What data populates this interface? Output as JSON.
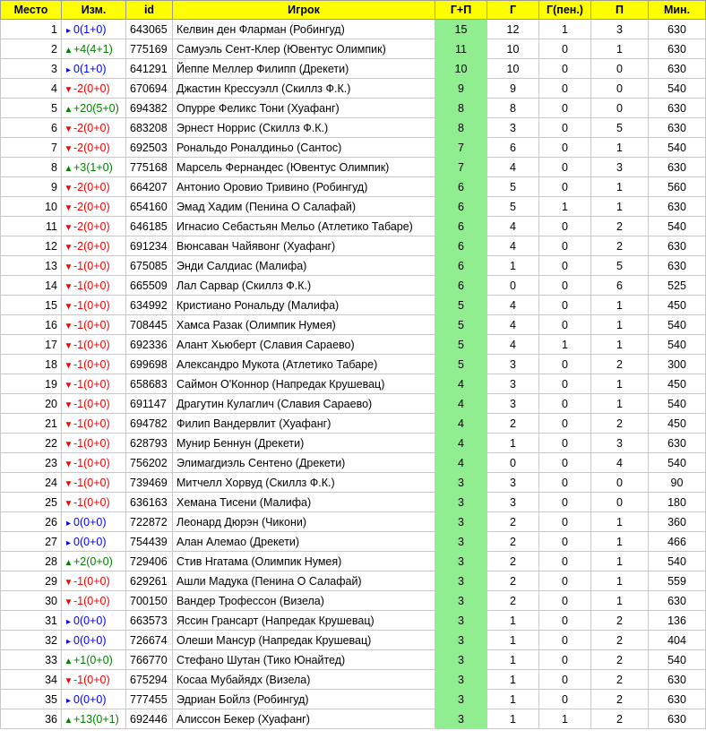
{
  "headers": [
    "Место",
    "Изм.",
    "id",
    "Игрок",
    "Г+П",
    "Г",
    "Г(пен.)",
    "П",
    "Мин."
  ],
  "colors": {
    "header_bg": "#ffff00",
    "gp_bg": "#90ee90",
    "up": "#008000",
    "down": "#ff0000",
    "same": "#0000ff"
  },
  "rows": [
    {
      "rank": "1",
      "dir": "same",
      "chg": "0(1+0)",
      "id": "643065",
      "name": "Келвин ден Фларман (Робингуд)",
      "gp": "15",
      "g": "12",
      "gpen": "1",
      "p": "3",
      "min": "630"
    },
    {
      "rank": "2",
      "dir": "up",
      "chg": "+4(4+1)",
      "id": "775169",
      "name": "Самуэль Сент-Клер (Ювентус Олимпик)",
      "gp": "11",
      "g": "10",
      "gpen": "0",
      "p": "1",
      "min": "630"
    },
    {
      "rank": "3",
      "dir": "same",
      "chg": "0(1+0)",
      "id": "641291",
      "name": "Йеппе Меллер Филипп (Дрекети)",
      "gp": "10",
      "g": "10",
      "gpen": "0",
      "p": "0",
      "min": "630"
    },
    {
      "rank": "4",
      "dir": "down",
      "chg": "-2(0+0)",
      "id": "670694",
      "name": "Джастин Крессуэлл (Скиллз Ф.К.)",
      "gp": "9",
      "g": "9",
      "gpen": "0",
      "p": "0",
      "min": "540"
    },
    {
      "rank": "5",
      "dir": "up",
      "chg": "+20(5+0)",
      "id": "694382",
      "name": "Опурре Феликс Тони (Хуафанг)",
      "gp": "8",
      "g": "8",
      "gpen": "0",
      "p": "0",
      "min": "630"
    },
    {
      "rank": "6",
      "dir": "down",
      "chg": "-2(0+0)",
      "id": "683208",
      "name": "Эрнест Норрис (Скиллз Ф.К.)",
      "gp": "8",
      "g": "3",
      "gpen": "0",
      "p": "5",
      "min": "630"
    },
    {
      "rank": "7",
      "dir": "down",
      "chg": "-2(0+0)",
      "id": "692503",
      "name": "Рональдо Роналдиньо (Сантос)",
      "gp": "7",
      "g": "6",
      "gpen": "0",
      "p": "1",
      "min": "540"
    },
    {
      "rank": "8",
      "dir": "up",
      "chg": "+3(1+0)",
      "id": "775168",
      "name": "Марсель Фернандес (Ювентус Олимпик)",
      "gp": "7",
      "g": "4",
      "gpen": "0",
      "p": "3",
      "min": "630"
    },
    {
      "rank": "9",
      "dir": "down",
      "chg": "-2(0+0)",
      "id": "664207",
      "name": "Антонио Оровио Тривино (Робингуд)",
      "gp": "6",
      "g": "5",
      "gpen": "0",
      "p": "1",
      "min": "560"
    },
    {
      "rank": "10",
      "dir": "down",
      "chg": "-2(0+0)",
      "id": "654160",
      "name": "Эмад Хадим (Пенина О Салафай)",
      "gp": "6",
      "g": "5",
      "gpen": "1",
      "p": "1",
      "min": "630"
    },
    {
      "rank": "11",
      "dir": "down",
      "chg": "-2(0+0)",
      "id": "646185",
      "name": "Игнасио Себастьян Мельо (Атлетико Табаре)",
      "gp": "6",
      "g": "4",
      "gpen": "0",
      "p": "2",
      "min": "540"
    },
    {
      "rank": "12",
      "dir": "down",
      "chg": "-2(0+0)",
      "id": "691234",
      "name": "Вюнсаван Чайявонг (Хуафанг)",
      "gp": "6",
      "g": "4",
      "gpen": "0",
      "p": "2",
      "min": "630"
    },
    {
      "rank": "13",
      "dir": "down",
      "chg": "-1(0+0)",
      "id": "675085",
      "name": "Энди Салдиас (Малифа)",
      "gp": "6",
      "g": "1",
      "gpen": "0",
      "p": "5",
      "min": "630"
    },
    {
      "rank": "14",
      "dir": "down",
      "chg": "-1(0+0)",
      "id": "665509",
      "name": "Лал Сарвар (Скиллз Ф.К.)",
      "gp": "6",
      "g": "0",
      "gpen": "0",
      "p": "6",
      "min": "525"
    },
    {
      "rank": "15",
      "dir": "down",
      "chg": "-1(0+0)",
      "id": "634992",
      "name": "Кристиано Рональду (Малифа)",
      "gp": "5",
      "g": "4",
      "gpen": "0",
      "p": "1",
      "min": "450"
    },
    {
      "rank": "16",
      "dir": "down",
      "chg": "-1(0+0)",
      "id": "708445",
      "name": "Хамса Разак (Олимпик Нумея)",
      "gp": "5",
      "g": "4",
      "gpen": "0",
      "p": "1",
      "min": "540"
    },
    {
      "rank": "17",
      "dir": "down",
      "chg": "-1(0+0)",
      "id": "692336",
      "name": "Алант Хьюберт (Славия Сараево)",
      "gp": "5",
      "g": "4",
      "gpen": "1",
      "p": "1",
      "min": "540"
    },
    {
      "rank": "18",
      "dir": "down",
      "chg": "-1(0+0)",
      "id": "699698",
      "name": "Александро Мукота (Атлетико Табаре)",
      "gp": "5",
      "g": "3",
      "gpen": "0",
      "p": "2",
      "min": "300"
    },
    {
      "rank": "19",
      "dir": "down",
      "chg": "-1(0+0)",
      "id": "658683",
      "name": "Саймон О'Коннор (Напредак Крушевац)",
      "gp": "4",
      "g": "3",
      "gpen": "0",
      "p": "1",
      "min": "450"
    },
    {
      "rank": "20",
      "dir": "down",
      "chg": "-1(0+0)",
      "id": "691147",
      "name": "Драгутин Кулаглич (Славия Сараево)",
      "gp": "4",
      "g": "3",
      "gpen": "0",
      "p": "1",
      "min": "540"
    },
    {
      "rank": "21",
      "dir": "down",
      "chg": "-1(0+0)",
      "id": "694782",
      "name": "Филип Вандервлит (Хуафанг)",
      "gp": "4",
      "g": "2",
      "gpen": "0",
      "p": "2",
      "min": "450"
    },
    {
      "rank": "22",
      "dir": "down",
      "chg": "-1(0+0)",
      "id": "628793",
      "name": "Мунир Беннун (Дрекети)",
      "gp": "4",
      "g": "1",
      "gpen": "0",
      "p": "3",
      "min": "630"
    },
    {
      "rank": "23",
      "dir": "down",
      "chg": "-1(0+0)",
      "id": "756202",
      "name": "Элимагдиэль Сентено (Дрекети)",
      "gp": "4",
      "g": "0",
      "gpen": "0",
      "p": "4",
      "min": "540"
    },
    {
      "rank": "24",
      "dir": "down",
      "chg": "-1(0+0)",
      "id": "739469",
      "name": "Митчелл Хорвуд (Скиллз Ф.К.)",
      "gp": "3",
      "g": "3",
      "gpen": "0",
      "p": "0",
      "min": "90"
    },
    {
      "rank": "25",
      "dir": "down",
      "chg": "-1(0+0)",
      "id": "636163",
      "name": "Хемана Тисени (Малифа)",
      "gp": "3",
      "g": "3",
      "gpen": "0",
      "p": "0",
      "min": "180"
    },
    {
      "rank": "26",
      "dir": "same",
      "chg": "0(0+0)",
      "id": "722872",
      "name": "Леонард Дюрэн (Чикони)",
      "gp": "3",
      "g": "2",
      "gpen": "0",
      "p": "1",
      "min": "360"
    },
    {
      "rank": "27",
      "dir": "same",
      "chg": "0(0+0)",
      "id": "754439",
      "name": "Алан Алемао (Дрекети)",
      "gp": "3",
      "g": "2",
      "gpen": "0",
      "p": "1",
      "min": "466"
    },
    {
      "rank": "28",
      "dir": "up",
      "chg": "+2(0+0)",
      "id": "729406",
      "name": "Стив Нгатама (Олимпик Нумея)",
      "gp": "3",
      "g": "2",
      "gpen": "0",
      "p": "1",
      "min": "540"
    },
    {
      "rank": "29",
      "dir": "down",
      "chg": "-1(0+0)",
      "id": "629261",
      "name": "Ашли Мадука (Пенина О Салафай)",
      "gp": "3",
      "g": "2",
      "gpen": "0",
      "p": "1",
      "min": "559"
    },
    {
      "rank": "30",
      "dir": "down",
      "chg": "-1(0+0)",
      "id": "700150",
      "name": "Вандер Трофессон (Визела)",
      "gp": "3",
      "g": "2",
      "gpen": "0",
      "p": "1",
      "min": "630"
    },
    {
      "rank": "31",
      "dir": "same",
      "chg": "0(0+0)",
      "id": "663573",
      "name": "Яссин Грансарт (Напредак Крушевац)",
      "gp": "3",
      "g": "1",
      "gpen": "0",
      "p": "2",
      "min": "136"
    },
    {
      "rank": "32",
      "dir": "same",
      "chg": "0(0+0)",
      "id": "726674",
      "name": "Олеши Мансур (Напредак Крушевац)",
      "gp": "3",
      "g": "1",
      "gpen": "0",
      "p": "2",
      "min": "404"
    },
    {
      "rank": "33",
      "dir": "up",
      "chg": "+1(0+0)",
      "id": "766770",
      "name": "Стефано Шутан (Тико Юнайтед)",
      "gp": "3",
      "g": "1",
      "gpen": "0",
      "p": "2",
      "min": "540"
    },
    {
      "rank": "34",
      "dir": "down",
      "chg": "-1(0+0)",
      "id": "675294",
      "name": "Косаа Мубайядх (Визела)",
      "gp": "3",
      "g": "1",
      "gpen": "0",
      "p": "2",
      "min": "630"
    },
    {
      "rank": "35",
      "dir": "same",
      "chg": "0(0+0)",
      "id": "777455",
      "name": "Эдриан Бойлз (Робингуд)",
      "gp": "3",
      "g": "1",
      "gpen": "0",
      "p": "2",
      "min": "630"
    },
    {
      "rank": "36",
      "dir": "up",
      "chg": "+13(0+1)",
      "id": "692446",
      "name": "Алиссон Бекер (Хуафанг)",
      "gp": "3",
      "g": "1",
      "gpen": "1",
      "p": "2",
      "min": "630"
    }
  ]
}
